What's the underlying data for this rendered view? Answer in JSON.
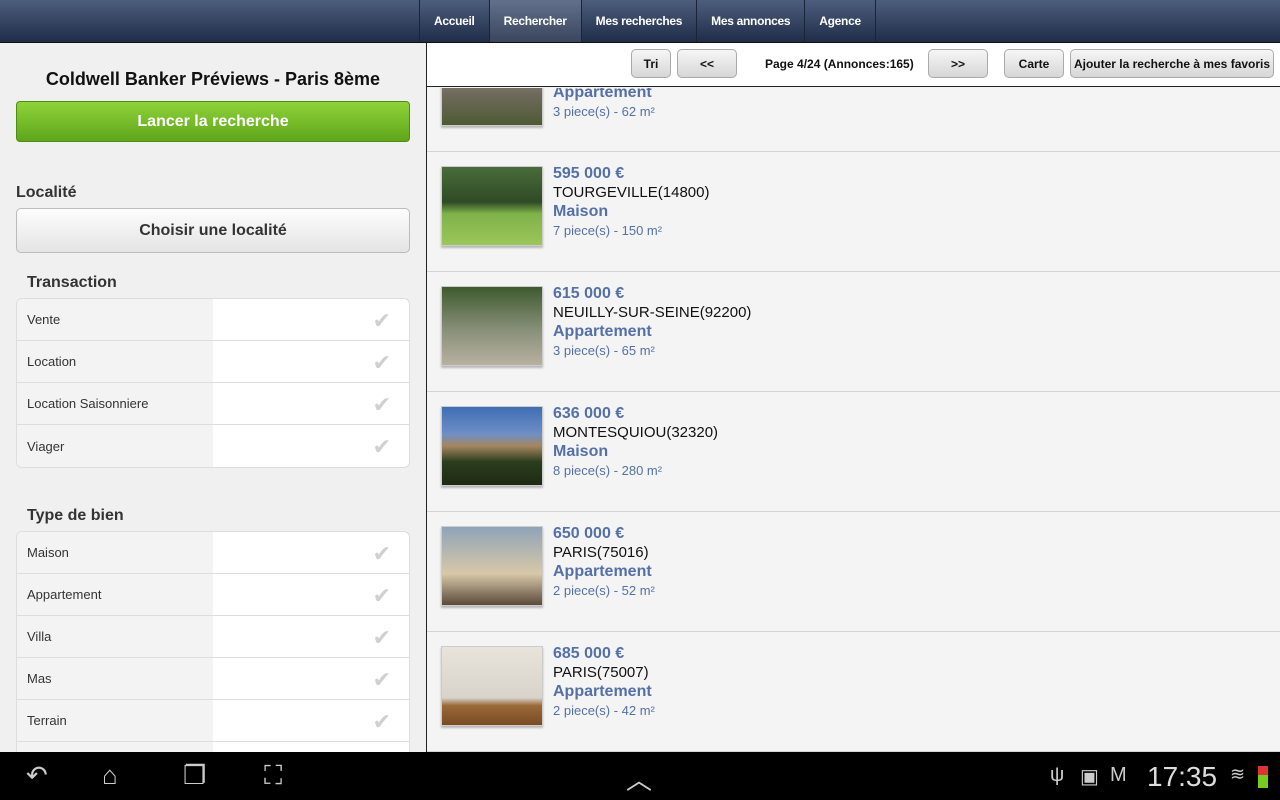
{
  "nav_tabs": [
    "Accueil",
    "Rechercher",
    "Mes recherches",
    "Mes annonces",
    "Agence"
  ],
  "active_tab": "Rechercher",
  "sidebar": {
    "title": "Coldwell Banker Préviews - Paris 8ème",
    "search_button": "Lancer la recherche",
    "locality_heading": "Localité",
    "locality_button": "Choisir une localité",
    "transaction_heading": "Transaction",
    "transactions": [
      "Vente",
      "Location",
      "Location Saisonniere",
      "Viager"
    ],
    "type_heading": "Type de bien",
    "types": [
      "Maison",
      "Appartement",
      "Villa",
      "Mas",
      "Terrain"
    ]
  },
  "toolbar": {
    "sort": "Tri",
    "prev": "<<",
    "page_info": "Page 4/24 (Annonces:165)",
    "next": ">>",
    "map": "Carte",
    "favorite": "Ajouter la recherche à mes favoris"
  },
  "listings": [
    {
      "price": "",
      "city": "",
      "type": "Appartement",
      "rooms": "3 piece(s) - 62 m²"
    },
    {
      "price": "595 000 €",
      "city": "TOURGEVILLE(14800)",
      "type": "Maison",
      "rooms": "7 piece(s) - 150 m²"
    },
    {
      "price": "615 000 €",
      "city": "NEUILLY-SUR-SEINE(92200)",
      "type": "Appartement",
      "rooms": "3 piece(s) - 65 m²"
    },
    {
      "price": "636 000 €",
      "city": "MONTESQUIOU(32320)",
      "type": "Maison",
      "rooms": "8 piece(s) - 280 m²"
    },
    {
      "price": "650 000 €",
      "city": "PARIS(75016)",
      "type": "Appartement",
      "rooms": "2 piece(s) - 52 m²"
    },
    {
      "price": "685 000 €",
      "city": "PARIS(75007)",
      "type": "Appartement",
      "rooms": "2 piece(s) - 42 m²"
    }
  ],
  "status_bar": {
    "time": "17:35"
  },
  "colors": {
    "accent_green": "#6db523",
    "link_blue": "#5470a6",
    "topbar": "#2c3a57"
  }
}
